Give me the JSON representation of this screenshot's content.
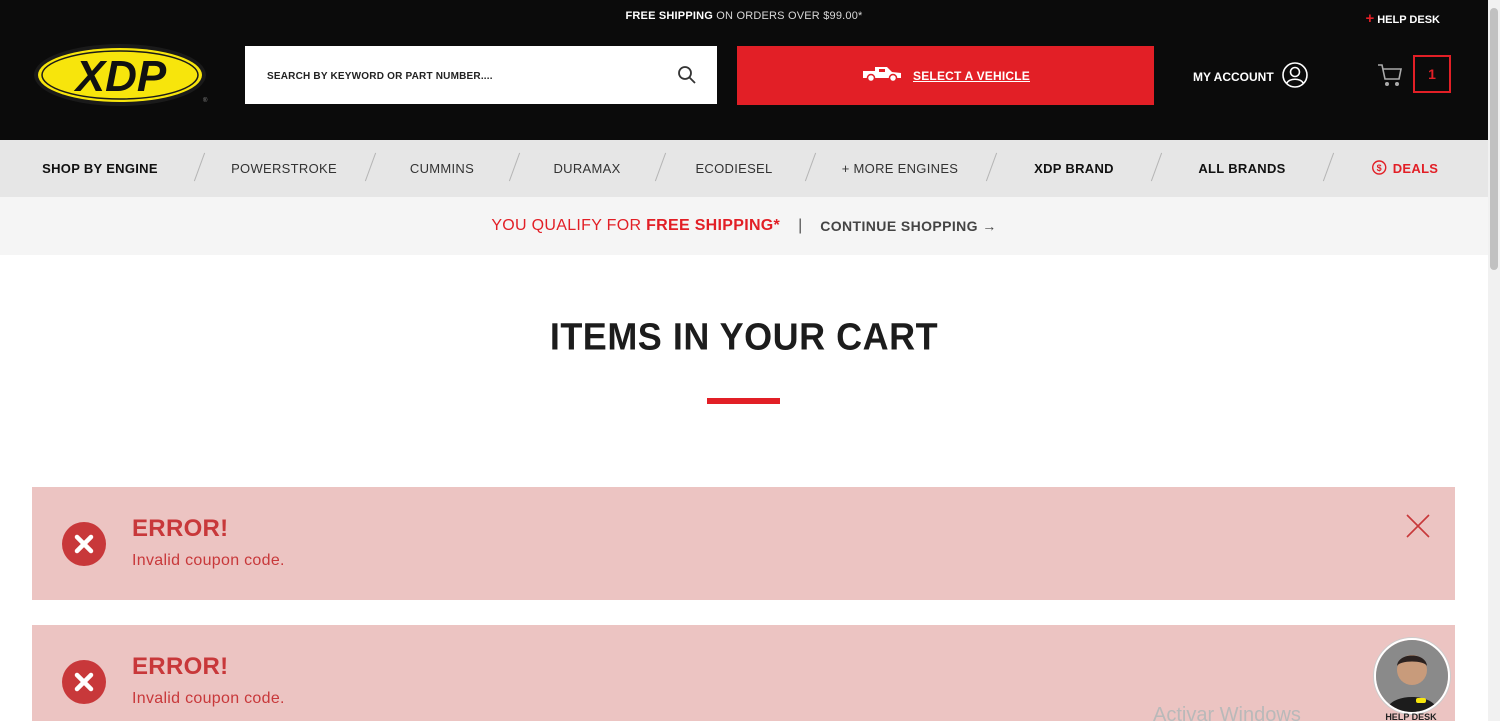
{
  "promo": {
    "bold": "FREE SHIPPING",
    "rest": " ON ORDERS OVER $99.00*"
  },
  "help_desk": "HELP DESK",
  "logo_text": "XDP",
  "search": {
    "placeholder": "SEARCH BY KEYWORD OR PART NUMBER....",
    "value": ""
  },
  "vehicle_button": "SELECT A VEHICLE",
  "account_label": "MY ACCOUNT",
  "cart_count": "1",
  "nav": {
    "shop_by_engine": "SHOP BY ENGINE",
    "powerstroke": "POWERSTROKE",
    "cummins": "CUMMINS",
    "duramax": "DURAMAX",
    "ecodiesel": "ECODIESEL",
    "more_engines": "+ MORE ENGINES",
    "xdp_brand": "XDP BRAND",
    "all_brands": "ALL BRANDS",
    "deals": "DEALS"
  },
  "shipping": {
    "qualify": "YOU QUALIFY FOR ",
    "free": "FREE SHIPPING*",
    "divider": "|",
    "continue": "CONTINUE SHOPPING"
  },
  "page_title": "ITEMS IN YOUR CART",
  "alerts": [
    {
      "title": "ERROR!",
      "message": "Invalid coupon code."
    },
    {
      "title": "ERROR!",
      "message": "Invalid coupon code."
    }
  ],
  "chat_label": "HELP DESK",
  "watermark": "Activar Windows",
  "colors": {
    "accent": "#e21f26",
    "header_bg": "#0b0b0b",
    "nav_bg": "#e6e6e6",
    "alert_bg": "#ecc4c2",
    "alert_text": "#c8383a"
  }
}
